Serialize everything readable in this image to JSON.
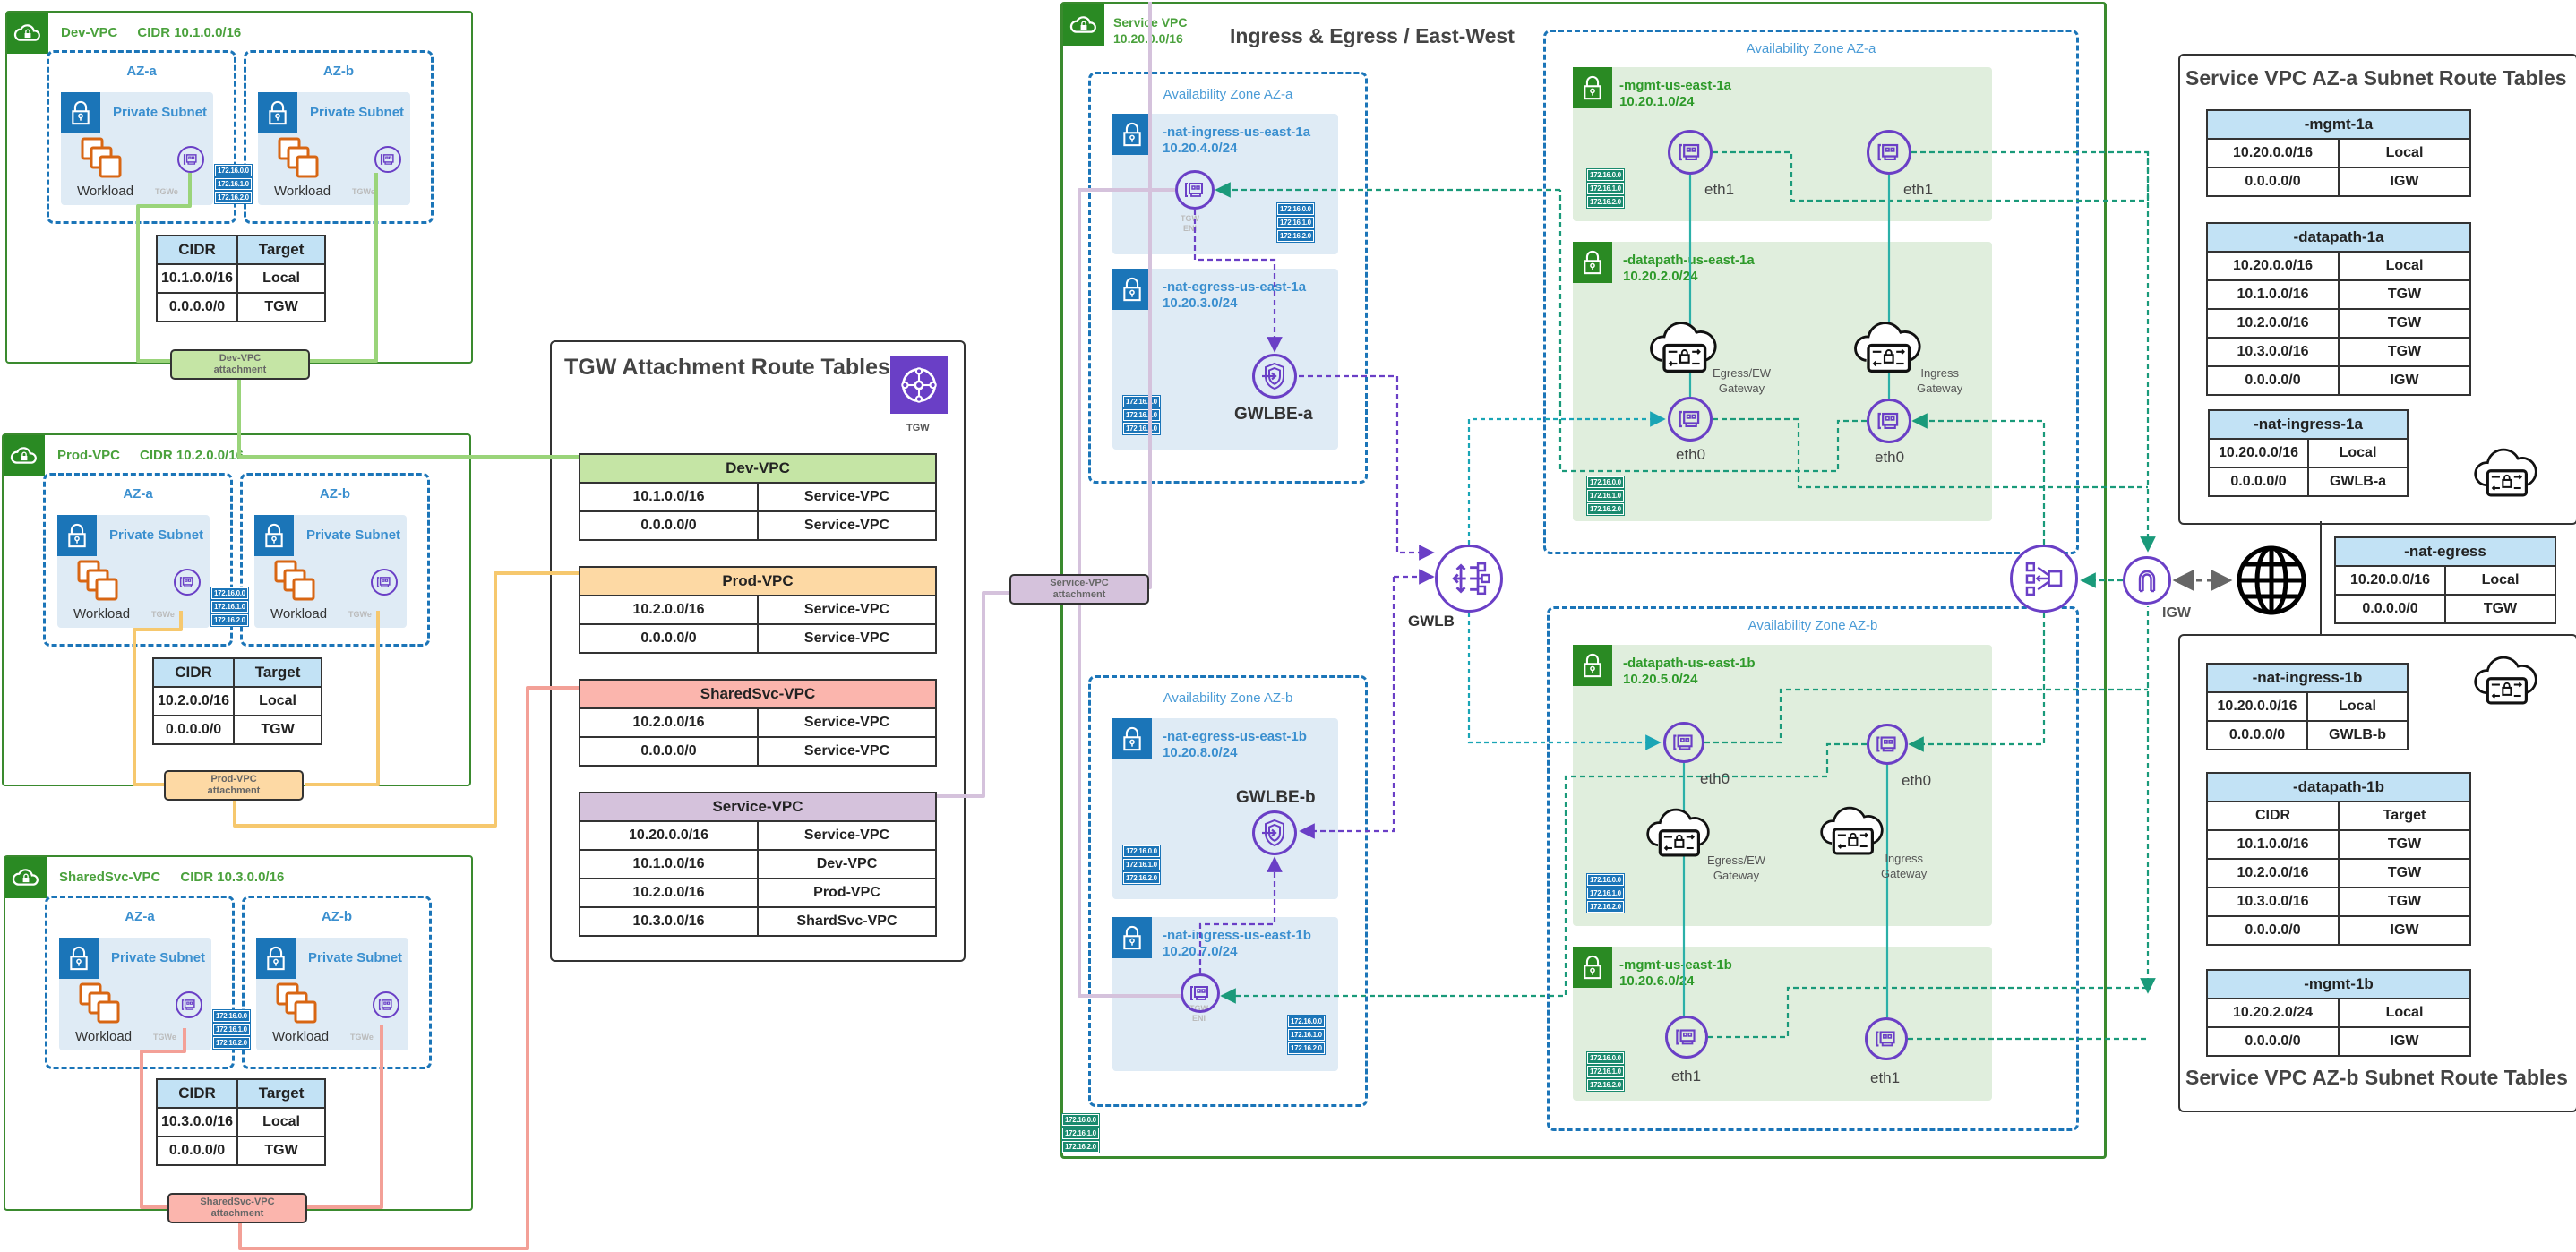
{
  "spoke_vpcs": [
    {
      "name": "Dev-VPC",
      "cidr_label": "CIDR 10.1.0.0/16",
      "az_labels": [
        "AZ-a",
        "AZ-b"
      ],
      "subnet_label": "Private Subnet",
      "workload_label": "Workload",
      "eni_tag": "TGWe",
      "route_table": {
        "headers": [
          "CIDR",
          "Target"
        ],
        "rows": [
          [
            "10.1.0.0/16",
            "Local"
          ],
          [
            "0.0.0.0/0",
            "TGW"
          ]
        ]
      },
      "attachment_label": [
        "Dev-VPC",
        "attachment"
      ],
      "color": "#c5e5a5",
      "line_color": "#9ad47a"
    },
    {
      "name": "Prod-VPC",
      "cidr_label": "CIDR 10.2.0.0/16",
      "az_labels": [
        "AZ-a",
        "AZ-b"
      ],
      "subnet_label": "Private Subnet",
      "workload_label": "Workload",
      "eni_tag": "TGWe",
      "route_table": {
        "headers": [
          "CIDR",
          "Target"
        ],
        "rows": [
          [
            "10.2.0.0/16",
            "Local"
          ],
          [
            "0.0.0.0/0",
            "TGW"
          ]
        ]
      },
      "attachment_label": [
        "Prod-VPC",
        "attachment"
      ],
      "color": "#fdd9a4",
      "line_color": "#f6c86e"
    },
    {
      "name": "SharedSvc-VPC",
      "cidr_label": "CIDR 10.3.0.0/16",
      "az_labels": [
        "AZ-a",
        "AZ-b"
      ],
      "subnet_label": "Private Subnet",
      "workload_label": "Workload",
      "eni_tag": "TGWe",
      "route_table": {
        "headers": [
          "CIDR",
          "Target"
        ],
        "rows": [
          [
            "10.3.0.0/16",
            "Local"
          ],
          [
            "0.0.0.0/0",
            "TGW"
          ]
        ]
      },
      "attachment_label": [
        "SharedSvc-VPC",
        "attachment"
      ],
      "color": "#fbb5ad",
      "line_color": "#f3a097"
    }
  ],
  "ip_tags": [
    "172.16.0.0",
    "172.16.1.0",
    "172.16.2.0"
  ],
  "tgw_panel": {
    "title": "TGW Attachment Route Tables",
    "icon_label": "TGW",
    "tables": [
      {
        "name": "Dev-VPC",
        "color": "#c5e5a5",
        "rows": [
          [
            "10.1.0.0/16",
            "Service-VPC"
          ],
          [
            "0.0.0.0/0",
            "Service-VPC"
          ]
        ]
      },
      {
        "name": "Prod-VPC",
        "color": "#fdd9a4",
        "rows": [
          [
            "10.2.0.0/16",
            "Service-VPC"
          ],
          [
            "0.0.0.0/0",
            "Service-VPC"
          ]
        ]
      },
      {
        "name": "SharedSvc-VPC",
        "color": "#fbb5ad",
        "rows": [
          [
            "10.2.0.0/16",
            "Service-VPC"
          ],
          [
            "0.0.0.0/0",
            "Service-VPC"
          ]
        ]
      },
      {
        "name": "Service-VPC",
        "color": "#d5c2dc",
        "rows": [
          [
            "10.20.0.0/16",
            "Service-VPC"
          ],
          [
            "10.1.0.0/16",
            "Dev-VPC"
          ],
          [
            "10.2.0.0/16",
            "Prod-VPC"
          ],
          [
            "10.3.0.0/16",
            "ShardSvc-VPC"
          ]
        ]
      }
    ]
  },
  "service_attachment_label": [
    "Service-VPC",
    "attachment"
  ],
  "service_vpc": {
    "name": "Service VPC",
    "cidr": "10.20.0.0/16",
    "heading": "Ingress & Egress / East-West",
    "left_az_a": {
      "label": "Availability Zone AZ-a",
      "subnets": [
        {
          "name": "-nat-ingress-us-east-1a",
          "cidr": "10.20.4.0/24",
          "eni_tag": [
            "TGW",
            "ENI"
          ]
        },
        {
          "name": "-nat-egress-us-east-1a",
          "cidr": "10.20.3.0/24",
          "endpoint_label": "GWLBE-a"
        }
      ]
    },
    "left_az_b": {
      "label": "Availability Zone AZ-b",
      "subnets": [
        {
          "name": "-nat-egress-us-east-1b",
          "cidr": "10.20.8.0/24",
          "endpoint_label": "GWLBE-b"
        },
        {
          "name": "-nat-ingress-us-east-1b",
          "cidr": "10.20.7.0/24",
          "eni_tag": [
            "TGW",
            "ENI"
          ]
        }
      ]
    },
    "gwlb_label": "GWLB",
    "right_az_a": {
      "label": "Availability Zone AZ-a",
      "mgmt": {
        "name": "-mgmt-us-east-1a",
        "cidr": "10.20.1.0/24",
        "eni_labels": [
          "eth1",
          "eth1"
        ]
      },
      "datapath": {
        "name": "-datapath-us-east-1a",
        "cidr": "10.20.2.0/24",
        "eni_labels": [
          "eth0",
          "eth0"
        ],
        "gateways": [
          [
            "Egress/EW",
            "Gateway"
          ],
          [
            "Ingress",
            "Gateway"
          ]
        ]
      }
    },
    "right_az_b": {
      "label": "Availability Zone AZ-b",
      "datapath": {
        "name": "-datapath-us-east-1b",
        "cidr": "10.20.5.0/24",
        "eni_labels": [
          "eth0",
          "eth0"
        ],
        "gateways": [
          [
            "Egress/EW",
            "Gateway"
          ],
          [
            "Ingress",
            "Gateway"
          ]
        ]
      },
      "mgmt": {
        "name": "-mgmt-us-east-1b",
        "cidr": "10.20.6.0/24",
        "eni_labels": [
          "eth1",
          "eth1"
        ]
      }
    },
    "igw_label": "IGW"
  },
  "az_a_route_panel": {
    "title": "Service VPC AZ-a Subnet Route Tables",
    "tables": [
      {
        "name": "-mgmt-1a",
        "rows": [
          [
            "10.20.0.0/16",
            "Local"
          ],
          [
            "0.0.0.0/0",
            "IGW"
          ]
        ]
      },
      {
        "name": "-datapath-1a",
        "rows": [
          [
            "10.20.0.0/16",
            "Local"
          ],
          [
            "10.1.0.0/16",
            "TGW"
          ],
          [
            "10.2.0.0/16",
            "TGW"
          ],
          [
            "10.3.0.0/16",
            "TGW"
          ],
          [
            "0.0.0.0/0",
            "IGW"
          ]
        ]
      },
      {
        "name": "-nat-ingress-1a",
        "rows": [
          [
            "10.20.0.0/16",
            "Local"
          ],
          [
            "0.0.0.0/0",
            "GWLB-a"
          ]
        ]
      }
    ]
  },
  "nat_egress_table": {
    "name": "-nat-egress",
    "rows": [
      [
        "10.20.0.0/16",
        "Local"
      ],
      [
        "0.0.0.0/0",
        "TGW"
      ]
    ]
  },
  "az_b_route_panel": {
    "title": "Service VPC AZ-b Subnet Route Tables",
    "tables": [
      {
        "name": "-nat-ingress-1b",
        "rows": [
          [
            "10.20.0.0/16",
            "Local"
          ],
          [
            "0.0.0.0/0",
            "GWLB-b"
          ]
        ]
      },
      {
        "name": "-datapath-1b",
        "rows": [
          [
            "CIDR",
            "Target"
          ],
          [
            "10.1.0.0/16",
            "TGW"
          ],
          [
            "10.2.0.0/16",
            "TGW"
          ],
          [
            "10.3.0.0/16",
            "TGW"
          ],
          [
            "0.0.0.0/0",
            "IGW"
          ]
        ]
      },
      {
        "name": "-mgmt-1b",
        "rows": [
          [
            "10.20.2.0/24",
            "Local"
          ],
          [
            "0.0.0.0/0",
            "IGW"
          ]
        ]
      }
    ]
  }
}
